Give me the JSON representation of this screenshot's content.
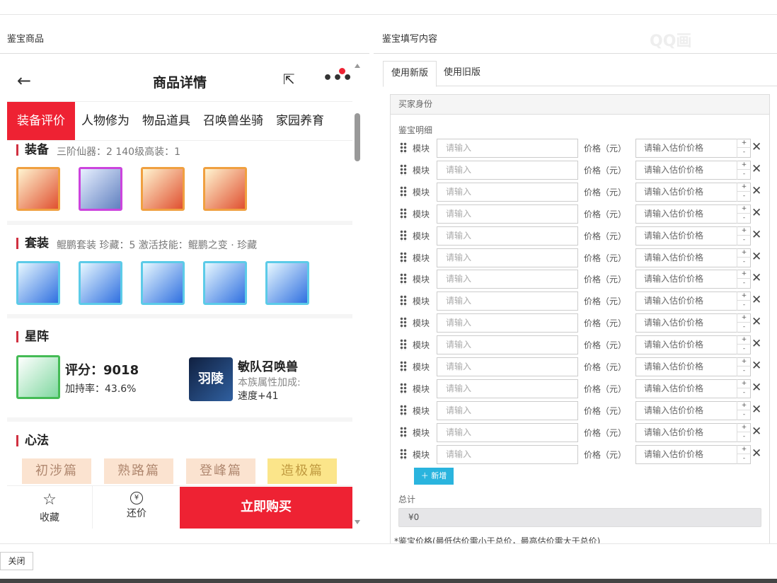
{
  "left_panel_title": "鉴宝商品",
  "right_panel_title": "鉴宝填写内容",
  "watermark": "QQ画",
  "phone": {
    "nav_title": "商品详情",
    "tabs": [
      "装备评价",
      "人物修为",
      "物品道具",
      "召唤兽坐骑",
      "家园养育"
    ],
    "equip": {
      "title": "装备",
      "sub": "三阶仙器：2   140级高装：1"
    },
    "suit": {
      "title": "套装",
      "sub": "鲲鹏套装   珍藏：5   激活技能：鲲鹏之变 · 珍藏"
    },
    "star": {
      "title": "星阵",
      "score": "评分：9018",
      "rate": "加持率：43.6%",
      "pet_name": "敏队召唤兽",
      "pet_bonus": "本族属性加成:",
      "pet_speed": "速度+41",
      "pet_logo": "羽陵"
    },
    "xinfa": {
      "title": "心法",
      "items": [
        "初涉篇",
        "熟路篇",
        "登峰篇",
        "造极篇"
      ]
    },
    "bottom": {
      "fav": "收藏",
      "bargain": "还价",
      "buy": "立即购买"
    }
  },
  "form": {
    "tabs": [
      "使用新版",
      "使用旧版"
    ],
    "buyer_identity": "买家身份",
    "detail_label": "鉴宝明细",
    "row_module_label": "模块",
    "row_module_placeholder": "请输入",
    "row_price_label": "价格（元）",
    "row_price_placeholder": "请输入估价价格",
    "row_count": 15,
    "add_label": "新增",
    "total_label": "总计",
    "total_value": "¥0",
    "note": "*鉴宝价格(最低估价需小于总价，最高估价需大于总价)"
  },
  "close_label": "关闭"
}
